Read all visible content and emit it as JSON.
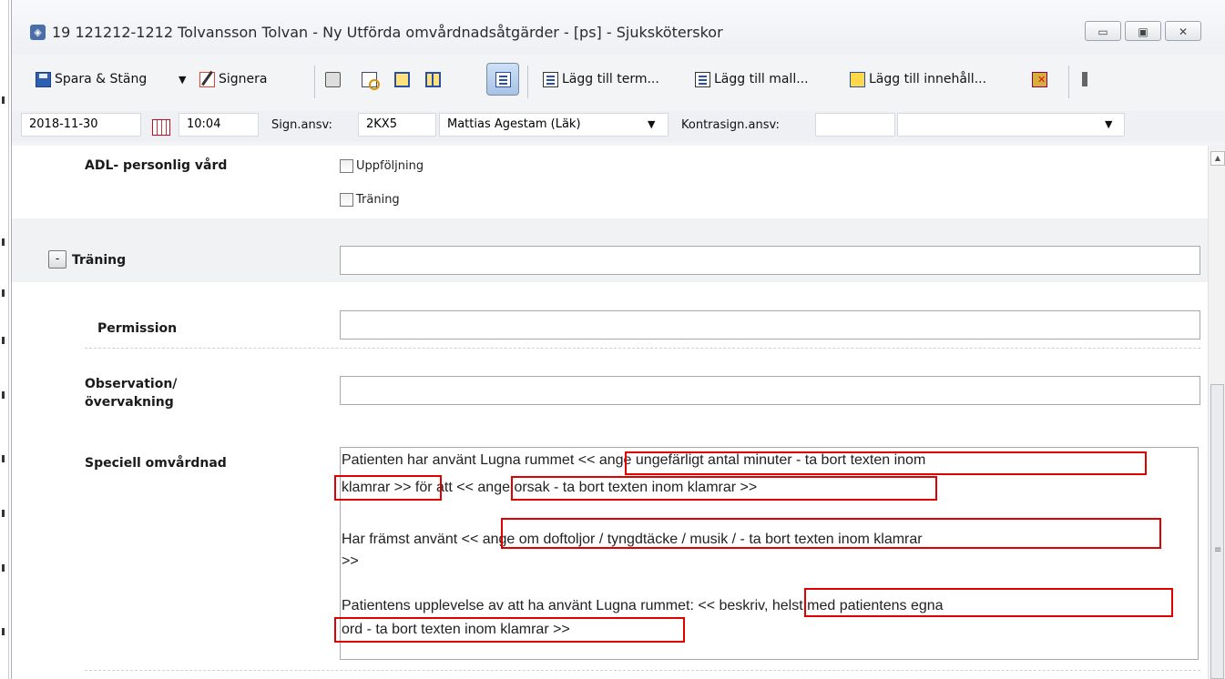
{
  "window": {
    "title": "19 121212-1212 Tolvansson Tolvan - Ny Utförda omvårdnadsåtgärder - [ps] - Sjuksköterskor",
    "buttons": [
      "minimize",
      "maximize",
      "close"
    ]
  },
  "toolbar": {
    "save_label": "Spara & Stäng",
    "sign_label": "Signera",
    "add_term_label": "Lägg till term...",
    "add_template_label": "Lägg till mall...",
    "add_content_label": "Lägg till innehåll..."
  },
  "fields": {
    "date": "2018-11-30",
    "time": "10:04",
    "sign_label": "Sign.ansv:",
    "sign_code": "2KX5",
    "sign_name": "Mattias Agestam (Läk)",
    "countersign_label": "Kontrasign.ansv:",
    "countersign_code": "",
    "countersign_name": ""
  },
  "form": {
    "adl_label": "ADL- personlig vård",
    "adl_options": [
      "Uppföljning",
      "Träning"
    ],
    "training_label": "Träning",
    "permission_label": "Permission",
    "observation_label_1": "Observation/",
    "observation_label_2": "övervakning",
    "special_label": "Speciell omvårdnad",
    "special_text": {
      "p1_a": "Patienten har använt Lugna rummet << ange ungefärligt antal minuter - ta bort texten inom",
      "p1_b": "klamrar >> för att << ange orsak - ta bort texten inom klamrar >>",
      "p2_a": "Har främst använt << ange om doftoljor / tyngdtäcke / musik /  - ta bort texten inom klamrar",
      "p2_b": ">>",
      "p3_a": "Patientens upplevelse av att ha använt Lugna rummet: << beskriv, helst med patientens egna",
      "p3_b": "ord - ta bort texten inom klamrar >>"
    }
  },
  "colors": {
    "highlight": "#e00000",
    "accent": "#2a4fa8"
  }
}
